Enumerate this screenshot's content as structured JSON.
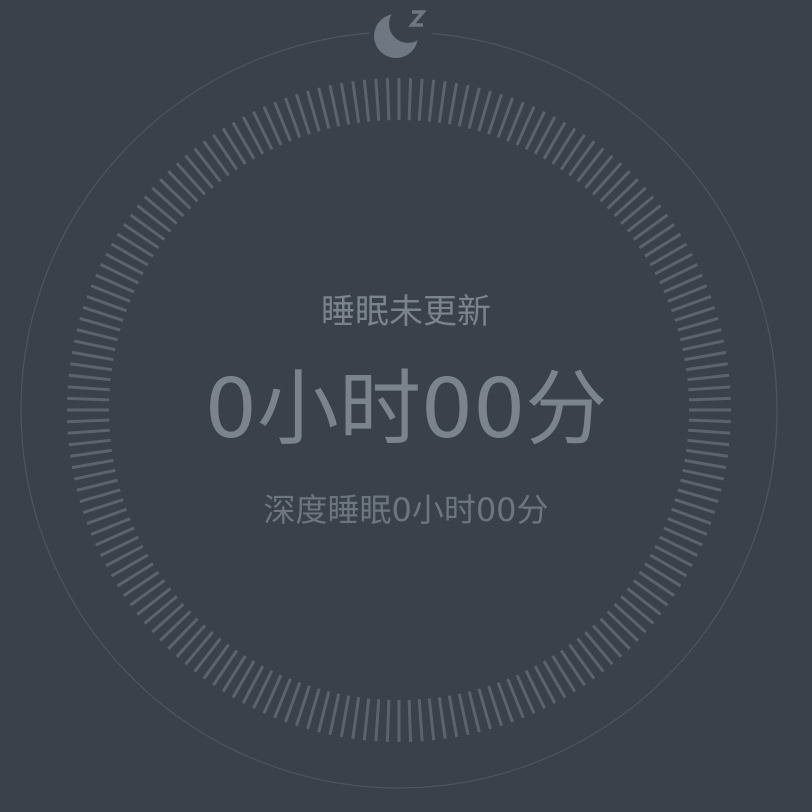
{
  "app": {
    "status_text": "睡眠未更新",
    "total_duration": "0小时00分",
    "deep_sleep": "深度睡眠0小时00分"
  },
  "colors": {
    "background": "#3a414b",
    "ring_ticks": "#5c636d",
    "outer_ring": "#4e5560",
    "text_primary": "#7b838d",
    "text_secondary": "#6d757f",
    "icon": "#6f7782"
  },
  "icons": {
    "sleep": "moon-zzz-icon"
  },
  "dial": {
    "tick_count": 180
  }
}
